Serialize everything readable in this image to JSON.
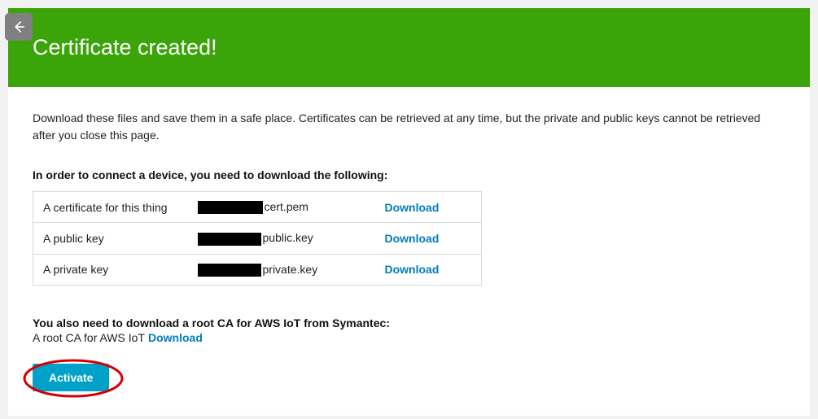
{
  "header": {
    "title": "Certificate created!"
  },
  "intro": "Download these files and save them in a safe place. Certificates can be retrieved at any time, but the private and public keys cannot be retrieved after you close this page.",
  "section_heading": "In order to connect a device, you need to download the following:",
  "files": [
    {
      "desc": "A certificate for this thing",
      "suffix": "cert.pem",
      "link": "Download"
    },
    {
      "desc": "A public key",
      "suffix": "public.key",
      "link": "Download"
    },
    {
      "desc": "A private key",
      "suffix": "private.key",
      "link": "Download"
    }
  ],
  "root_ca": {
    "heading": "You also need to download a root CA for AWS IoT from Symantec:",
    "text": "A root CA for AWS IoT",
    "link": "Download"
  },
  "buttons": {
    "activate": "Activate"
  }
}
